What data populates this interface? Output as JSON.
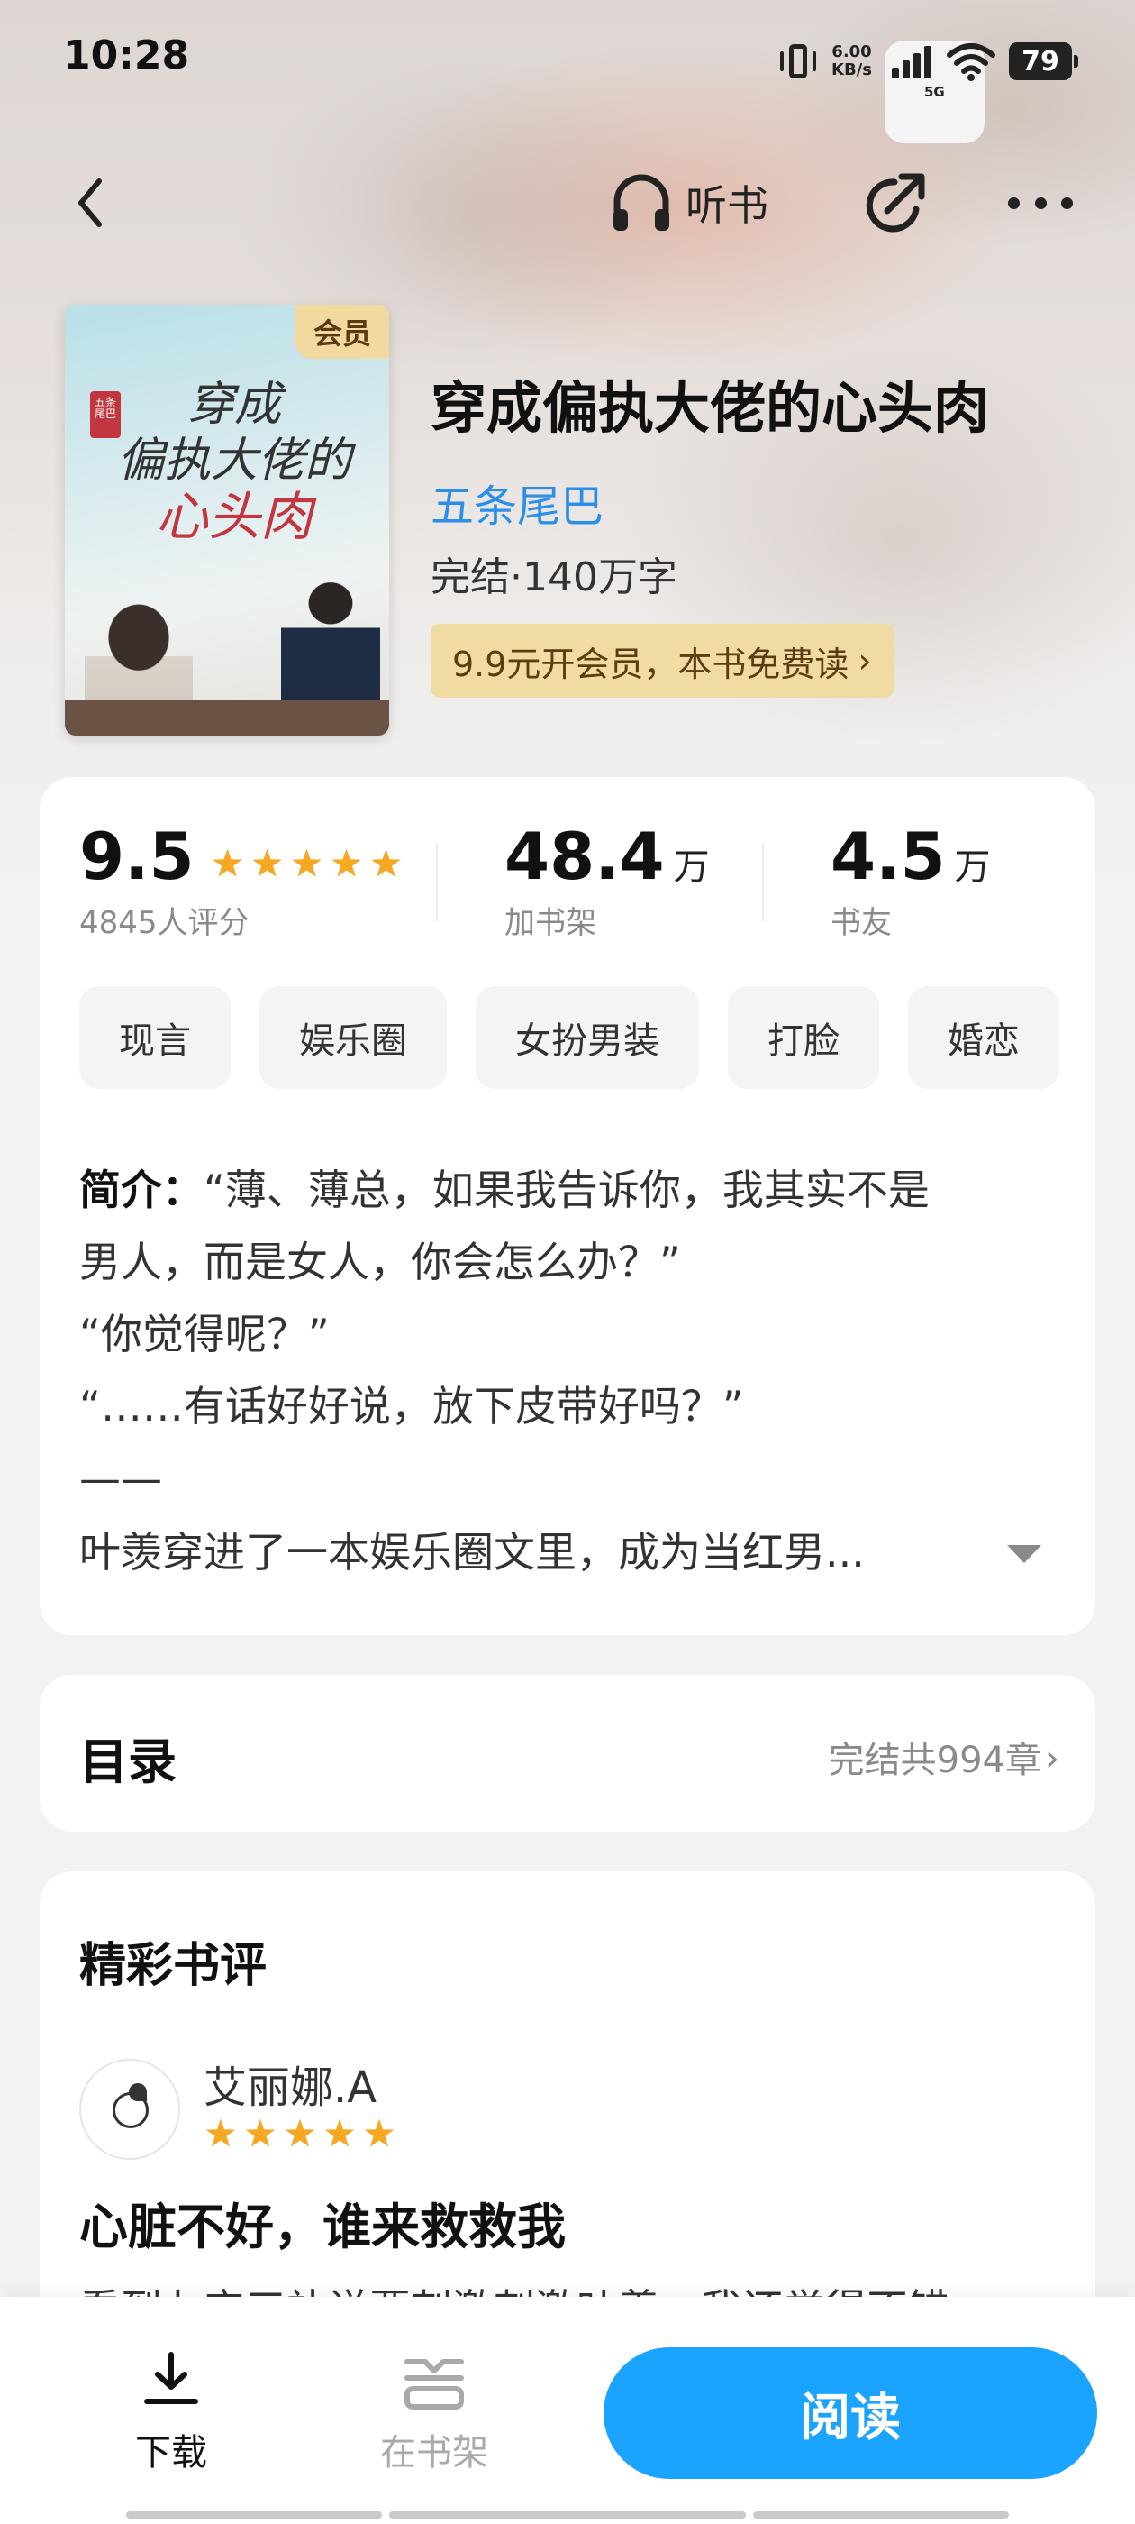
{
  "status_bar": {
    "time": "10:28",
    "net_speed_value": "6.00",
    "net_speed_unit": "KB/s",
    "network_type": "5G",
    "battery": "79"
  },
  "nav": {
    "listen_label": "听书",
    "icons": [
      "back-icon",
      "headphones-icon",
      "share-icon",
      "more-icon"
    ]
  },
  "book": {
    "cover_badge": "会员",
    "cover_line1": "穿成",
    "cover_line2": "偏执大佬的",
    "cover_line3": "心头肉",
    "cover_seal": "五条尾巴",
    "title": "穿成偏执大佬的心头肉",
    "author": "五条尾巴",
    "meta": "完结·140万字",
    "vip_promo": "9.9元开会员，本书免费读",
    "vip_promo_chevron": "›"
  },
  "stats": {
    "rating": "9.5",
    "rating_stars": 5,
    "rating_count": "4845人评分",
    "shelf_value": "48.4",
    "shelf_unit": "万",
    "shelf_label": "加书架",
    "friends_value": "4.5",
    "friends_unit": "万",
    "friends_label": "书友"
  },
  "tags": [
    "现言",
    "娱乐圈",
    "女扮男装",
    "打脸",
    "婚恋"
  ],
  "intro": {
    "prefix": "简介：",
    "line1": "“薄、薄总，如果我告诉你，我其实不是",
    "line2": "男人，而是女人，你会怎么办？”",
    "line3": "“你觉得呢？”",
    "line4": "“……有话好好说，放下皮带好吗？”",
    "line5": "——",
    "line6": "叶羡穿进了一本娱乐圈文里，成为当红男..."
  },
  "toc": {
    "title": "目录",
    "status": "完结共994章",
    "chevron": "›"
  },
  "reviews": {
    "heading": "精彩书评",
    "reviewer": "艾丽娜.A",
    "stars": 5,
    "title": "心脏不好，谁来救救我",
    "body": "看到七宝三补说要刺激刺激叶羡，我还觉得不错"
  },
  "bottom": {
    "download_label": "下载",
    "shelf_label": "在书架",
    "read_label": "阅读"
  },
  "colors": {
    "accent_blue": "#1aa3ff",
    "author_blue": "#2a8fe8",
    "star_orange": "#f7a823",
    "vip_gold": "#f0dca2"
  }
}
